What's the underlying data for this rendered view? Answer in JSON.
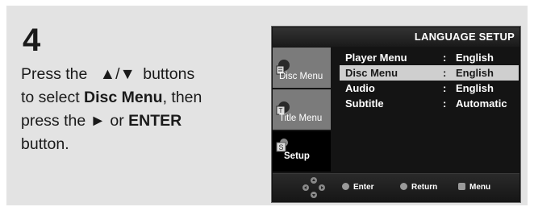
{
  "step": {
    "number": "4"
  },
  "instructions": {
    "line1_a": "Press the ",
    "line1_arrows": "▲/▼",
    "line1_b": " buttons",
    "line2_a": "to select ",
    "line2_bold": "Disc Menu",
    "line2_b": ", then",
    "line3_a": "press the ",
    "line3_arrow": "►",
    "line3_b": " or ",
    "line3_bold": "ENTER",
    "line4": " button."
  },
  "osd": {
    "title": "LANGUAGE SETUP",
    "sidebar": [
      {
        "label": "Disc Menu",
        "icon": "disc-menu-icon",
        "active": false
      },
      {
        "label": "Title Menu",
        "icon": "title-menu-icon",
        "active": false
      },
      {
        "label": "Setup",
        "icon": "setup-icon",
        "active": true
      }
    ],
    "menu": [
      {
        "label": "Player Menu",
        "colon": ":",
        "value": "English",
        "selected": false
      },
      {
        "label": "Disc Menu",
        "colon": ":",
        "value": "English",
        "selected": true
      },
      {
        "label": "Audio",
        "colon": ":",
        "value": "English",
        "selected": false
      },
      {
        "label": "Subtitle",
        "colon": ":",
        "value": "Automatic",
        "selected": false
      }
    ],
    "footer": {
      "enter": "Enter",
      "return": "Return",
      "menu": "Menu"
    }
  },
  "colors": {
    "panel_bg": "#e3e3e3",
    "osd_bg": "#141414",
    "sidebar_inactive": "#7b7b7b",
    "sidebar_active": "#000000",
    "selected_row": "#cfcfcf"
  }
}
